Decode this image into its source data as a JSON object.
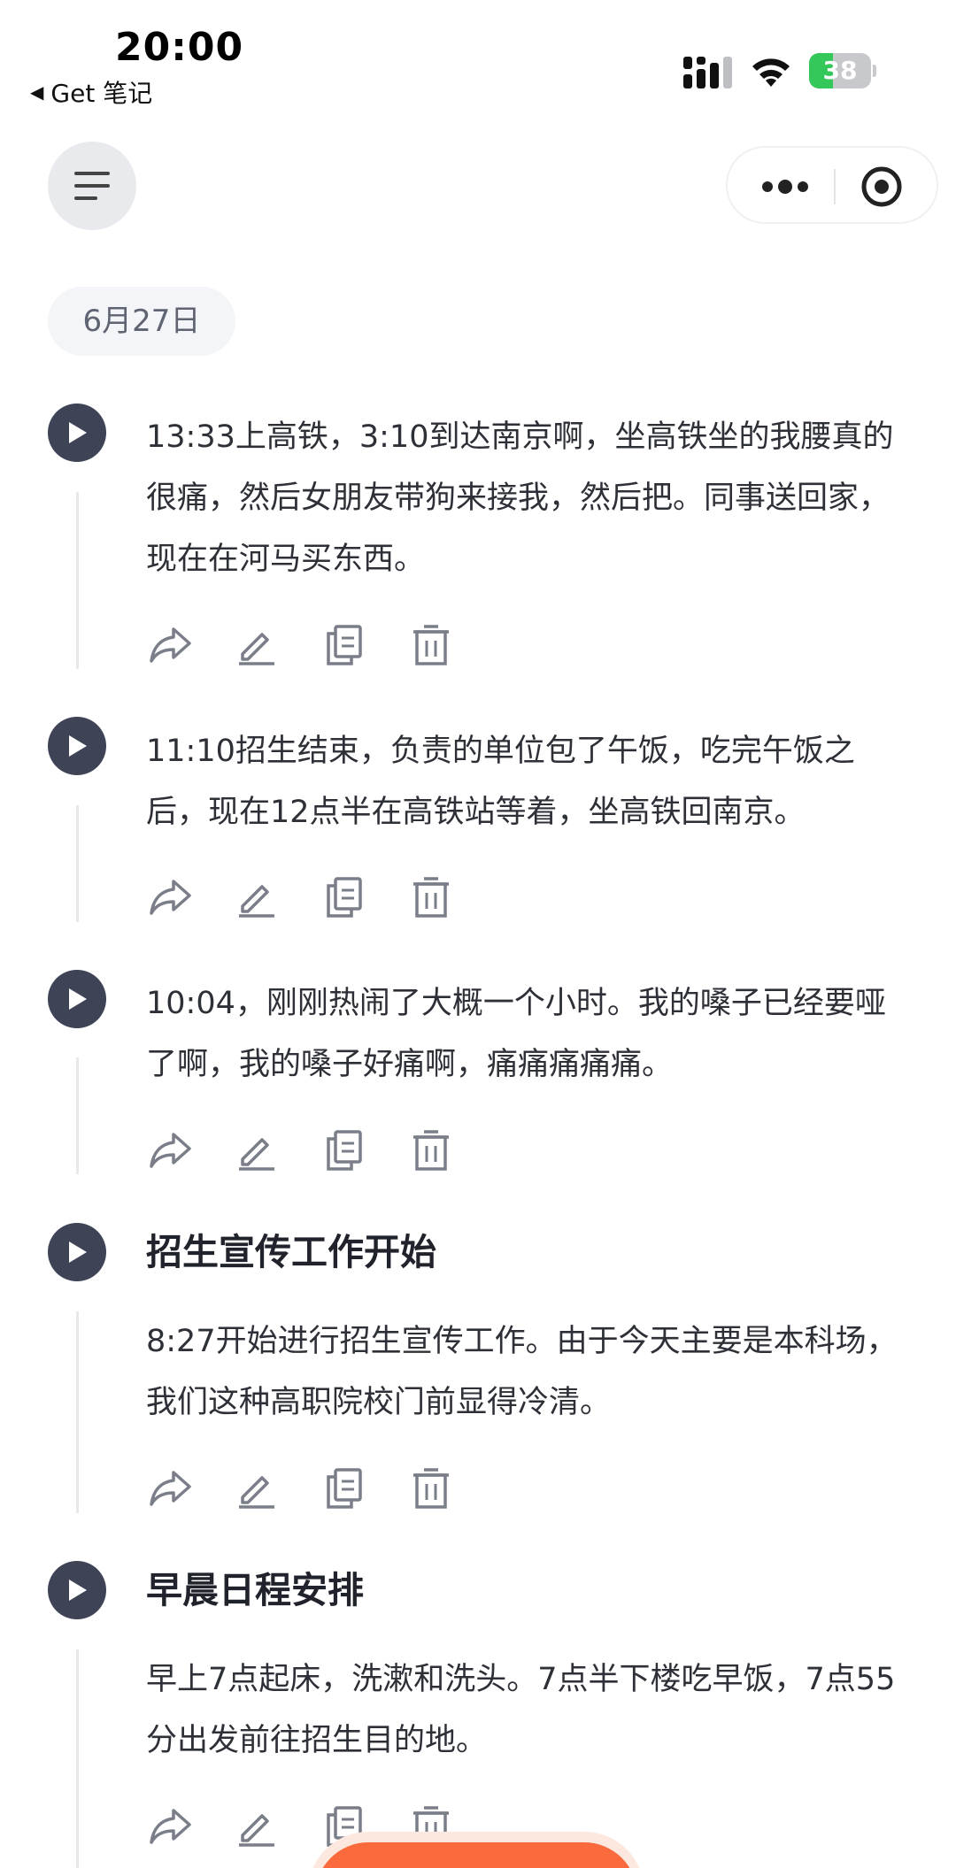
{
  "status_bar": {
    "time": "20:00",
    "back_app": "Get 笔记",
    "battery_level": "38",
    "battery_fraction": 0.38
  },
  "header": {
    "menu_icon": "hamburger-menu-icon",
    "more_icon": "more-dots-icon",
    "close_icon": "target-circle-icon"
  },
  "date_label": "6月27日",
  "entries": [
    {
      "title": "",
      "text": "13:33上高铁，3:10到达南京啊，坐高铁坐的我腰真的很痛，然后女朋友带狗来接我，然后把。同事送回家，现在在河马买东西。"
    },
    {
      "title": "",
      "text": "11:10招生结束，负责的单位包了午饭，吃完午饭之后，现在12点半在高铁站等着，坐高铁回南京。"
    },
    {
      "title": "",
      "text": "10:04，刚刚热闹了大概一个小时。我的嗓子已经要哑了啊，我的嗓子好痛啊，痛痛痛痛痛。"
    },
    {
      "title": "招生宣传工作开始",
      "text": "8:27开始进行招生宣传工作。由于今天主要是本科场，我们这种高职院校门前显得冷清。"
    },
    {
      "title": "早晨日程安排",
      "text": "早上7点起床，洗漱和洗头。7点半下楼吃早饭，7点55分出发前往招生目的地。"
    }
  ],
  "action_icons": [
    "share-icon",
    "edit-icon",
    "copy-icon",
    "delete-icon"
  ],
  "colors": {
    "accent": "#fa6a3c",
    "play_button": "#3e4356",
    "battery_green": "#34c759",
    "date_chip_bg": "#f4f5f8"
  }
}
